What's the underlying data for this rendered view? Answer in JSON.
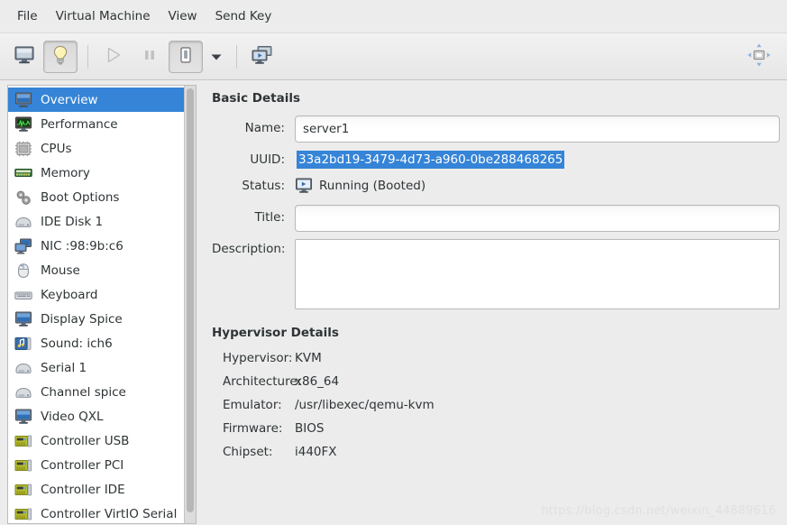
{
  "menubar": {
    "items": [
      {
        "label": "File",
        "name": "menu-file"
      },
      {
        "label": "Virtual Machine",
        "name": "menu-virtual-machine"
      },
      {
        "label": "View",
        "name": "menu-view"
      },
      {
        "label": "Send Key",
        "name": "menu-send-key"
      }
    ]
  },
  "toolbar": {
    "console_icon": "monitor-icon",
    "details_icon": "lightbulb-icon",
    "run_icon": "play-icon",
    "pause_icon": "pause-icon",
    "shutdown_icon": "power-icon",
    "shutdown_menu_icon": "chevron-down-icon",
    "snapshots_icon": "snapshots-icon",
    "fullscreen_icon": "fullscreen-icon"
  },
  "sidebar": {
    "items": [
      {
        "label": "Overview",
        "icon": "monitor-icon",
        "selected": true
      },
      {
        "label": "Performance",
        "icon": "graph-icon",
        "selected": false
      },
      {
        "label": "CPUs",
        "icon": "cpu-icon",
        "selected": false
      },
      {
        "label": "Memory",
        "icon": "memory-icon",
        "selected": false
      },
      {
        "label": "Boot Options",
        "icon": "gears-icon",
        "selected": false
      },
      {
        "label": "IDE Disk 1",
        "icon": "harddisk-icon",
        "selected": false
      },
      {
        "label": "NIC :98:9b:c6",
        "icon": "network-icon",
        "selected": false
      },
      {
        "label": "Mouse",
        "icon": "mouse-icon",
        "selected": false
      },
      {
        "label": "Keyboard",
        "icon": "keyboard-icon",
        "selected": false
      },
      {
        "label": "Display Spice",
        "icon": "display-icon",
        "selected": false
      },
      {
        "label": "Sound: ich6",
        "icon": "sound-icon",
        "selected": false
      },
      {
        "label": "Serial 1",
        "icon": "serial-icon",
        "selected": false
      },
      {
        "label": "Channel spice",
        "icon": "channel-icon",
        "selected": false
      },
      {
        "label": "Video QXL",
        "icon": "video-icon",
        "selected": false
      },
      {
        "label": "Controller USB",
        "icon": "controller-icon",
        "selected": false
      },
      {
        "label": "Controller PCI",
        "icon": "controller-icon",
        "selected": false
      },
      {
        "label": "Controller IDE",
        "icon": "controller-icon",
        "selected": false
      },
      {
        "label": "Controller VirtIO Serial",
        "icon": "controller-icon",
        "selected": false
      }
    ]
  },
  "basic_details": {
    "title": "Basic Details",
    "name_label": "Name:",
    "name_value": "server1",
    "uuid_label": "UUID:",
    "uuid_value": "33a2bd19-3479-4d73-a960-0be288468265",
    "status_label": "Status:",
    "status_value": "Running (Booted)",
    "status_icon": "running-icon",
    "title_label": "Title:",
    "title_value": "",
    "description_label": "Description:",
    "description_value": ""
  },
  "hypervisor_details": {
    "title": "Hypervisor Details",
    "rows": [
      {
        "label": "Hypervisor:",
        "value": "KVM"
      },
      {
        "label": "Architecture:",
        "value": "x86_64"
      },
      {
        "label": "Emulator:",
        "value": "/usr/libexec/qemu-kvm"
      },
      {
        "label": "Firmware:",
        "value": "BIOS"
      },
      {
        "label": "Chipset:",
        "value": "i440FX"
      }
    ]
  },
  "watermark": {
    "text": "https://blog.csdn.net/weixin_44889616"
  },
  "colors": {
    "selection_blue": "#3584d7",
    "window_bg": "#ececec",
    "text": "#2e3436"
  }
}
